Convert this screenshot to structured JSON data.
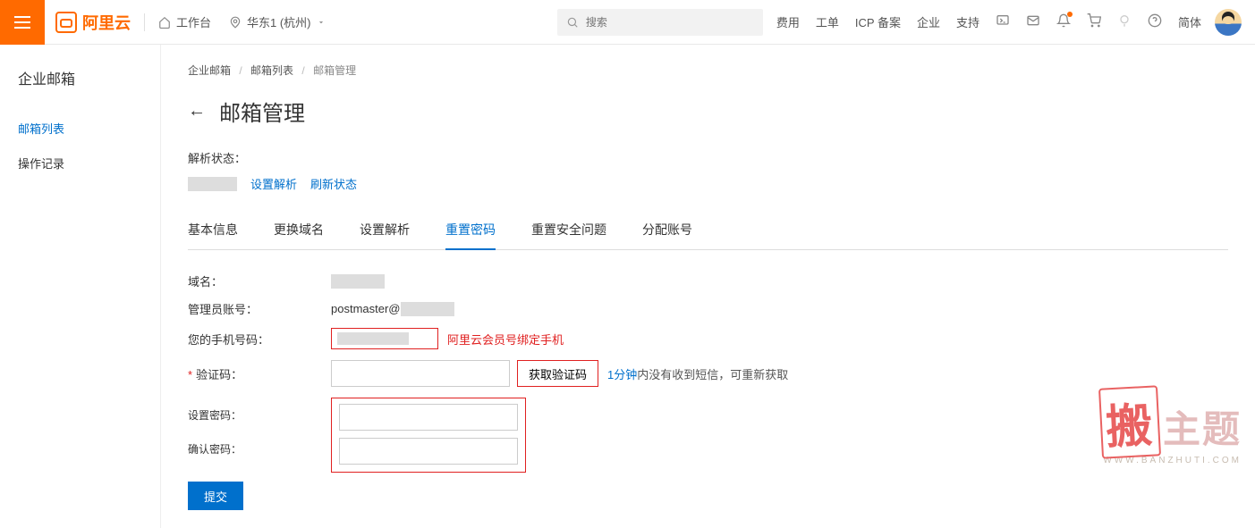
{
  "header": {
    "logo_text": "阿里云",
    "workbench": "工作台",
    "region": "华东1 (杭州)",
    "search_placeholder": "搜索",
    "links": [
      "费用",
      "工单",
      "ICP 备案",
      "企业",
      "支持"
    ],
    "lang": "简体"
  },
  "sidebar": {
    "title": "企业邮箱",
    "items": [
      {
        "label": "邮箱列表",
        "active": true
      },
      {
        "label": "操作记录",
        "active": false
      }
    ]
  },
  "breadcrumb": {
    "items": [
      "企业邮箱",
      "邮箱列表",
      "邮箱管理"
    ]
  },
  "page": {
    "title": "邮箱管理",
    "status_label": "解析状态：",
    "set_dns": "设置解析",
    "refresh": "刷新状态"
  },
  "tabs": [
    "基本信息",
    "更换域名",
    "设置解析",
    "重置密码",
    "重置安全问题",
    "分配账号"
  ],
  "active_tab": "重置密码",
  "form": {
    "domain_label": "域名：",
    "admin_label": "管理员账号：",
    "admin_value": "postmaster@",
    "phone_label": "您的手机号码：",
    "phone_hint": "阿里云会员号绑定手机",
    "code_label": "验证码：",
    "get_code": "获取验证码",
    "code_hint_blue": "1分钟",
    "code_hint_rest": "内没有收到短信，可重新获取",
    "set_pw_label": "设置密码：",
    "confirm_pw_label": "确认密码：",
    "submit": "提交"
  },
  "watermark": {
    "main_accent": "搬",
    "main_rest": "主题",
    "sub": "WWW.BANZHUTI.COM"
  }
}
